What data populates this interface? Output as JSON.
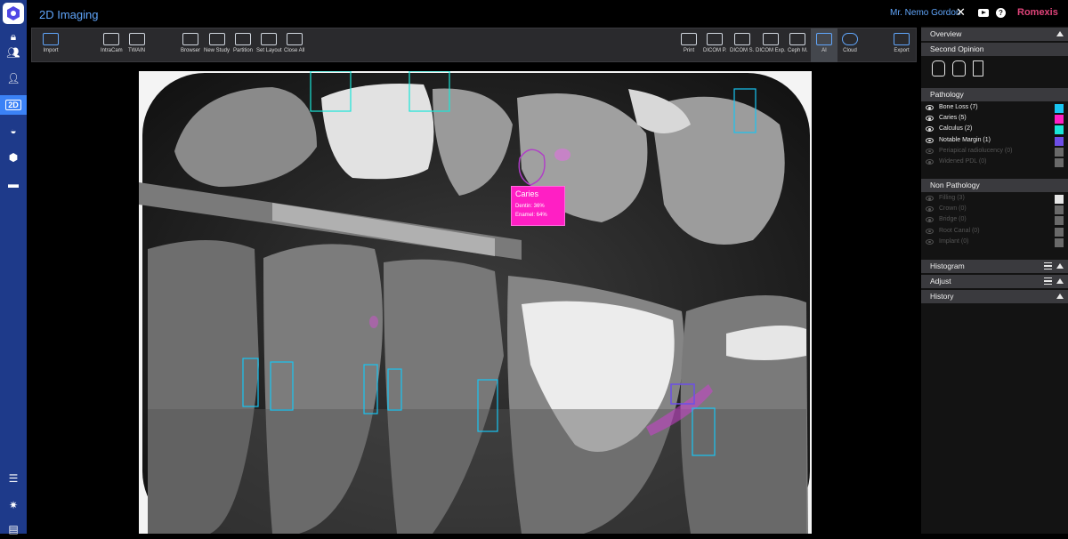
{
  "app": {
    "title": "2D Imaging",
    "user": "Mr. Nemo Gordon",
    "brand": "Romexis",
    "close_glyph": "✕",
    "help_glyph": "?"
  },
  "rail": {
    "tag": "2D"
  },
  "toolbar": {
    "left": [
      "Import",
      "IntraCam",
      "TWAIN",
      "Browser",
      "New Study",
      "Partition",
      "Set Layout",
      "Close All"
    ],
    "right": [
      "Print",
      "DICOM P.",
      "DICOM S.",
      "DICOM Exp.",
      "Ceph M.",
      "AI",
      "Cloud",
      "Export"
    ],
    "active": "AI"
  },
  "annotation": {
    "title": "Caries",
    "lines": [
      "Dentin: 36%",
      "Enamel: 64%"
    ]
  },
  "panel": {
    "overview": "Overview",
    "second_opinion": "Second Opinion",
    "pathology_title": "Pathology",
    "pathology": [
      {
        "label": "Bone Loss",
        "count": "(7)",
        "color": "#18c5f2",
        "active": true
      },
      {
        "label": "Caries",
        "count": "(5)",
        "color": "#ff1fc4",
        "active": true
      },
      {
        "label": "Calculus",
        "count": "(2)",
        "color": "#19e6d8",
        "active": true
      },
      {
        "label": "Notable Margin",
        "count": "(1)",
        "color": "#6d4ee8",
        "active": true
      },
      {
        "label": "Periapical radiolucency",
        "count": "(0)",
        "color": "#6a6a6a",
        "active": false
      },
      {
        "label": "Widened PDL",
        "count": "(0)",
        "color": "#6a6a6a",
        "active": false
      }
    ],
    "non_pathology_title": "Non Pathology",
    "non_pathology": [
      {
        "label": "Filling",
        "count": "(3)",
        "color": "#e6e6e6"
      },
      {
        "label": "Crown",
        "count": "(0)",
        "color": "#6a6a6a"
      },
      {
        "label": "Bridge",
        "count": "(0)",
        "color": "#6a6a6a"
      },
      {
        "label": "Root Canal",
        "count": "(0)",
        "color": "#6a6a6a"
      },
      {
        "label": "Implant",
        "count": "(0)",
        "color": "#6a6a6a"
      }
    ],
    "histogram": "Histogram",
    "adjust": "Adjust",
    "history": "History"
  }
}
